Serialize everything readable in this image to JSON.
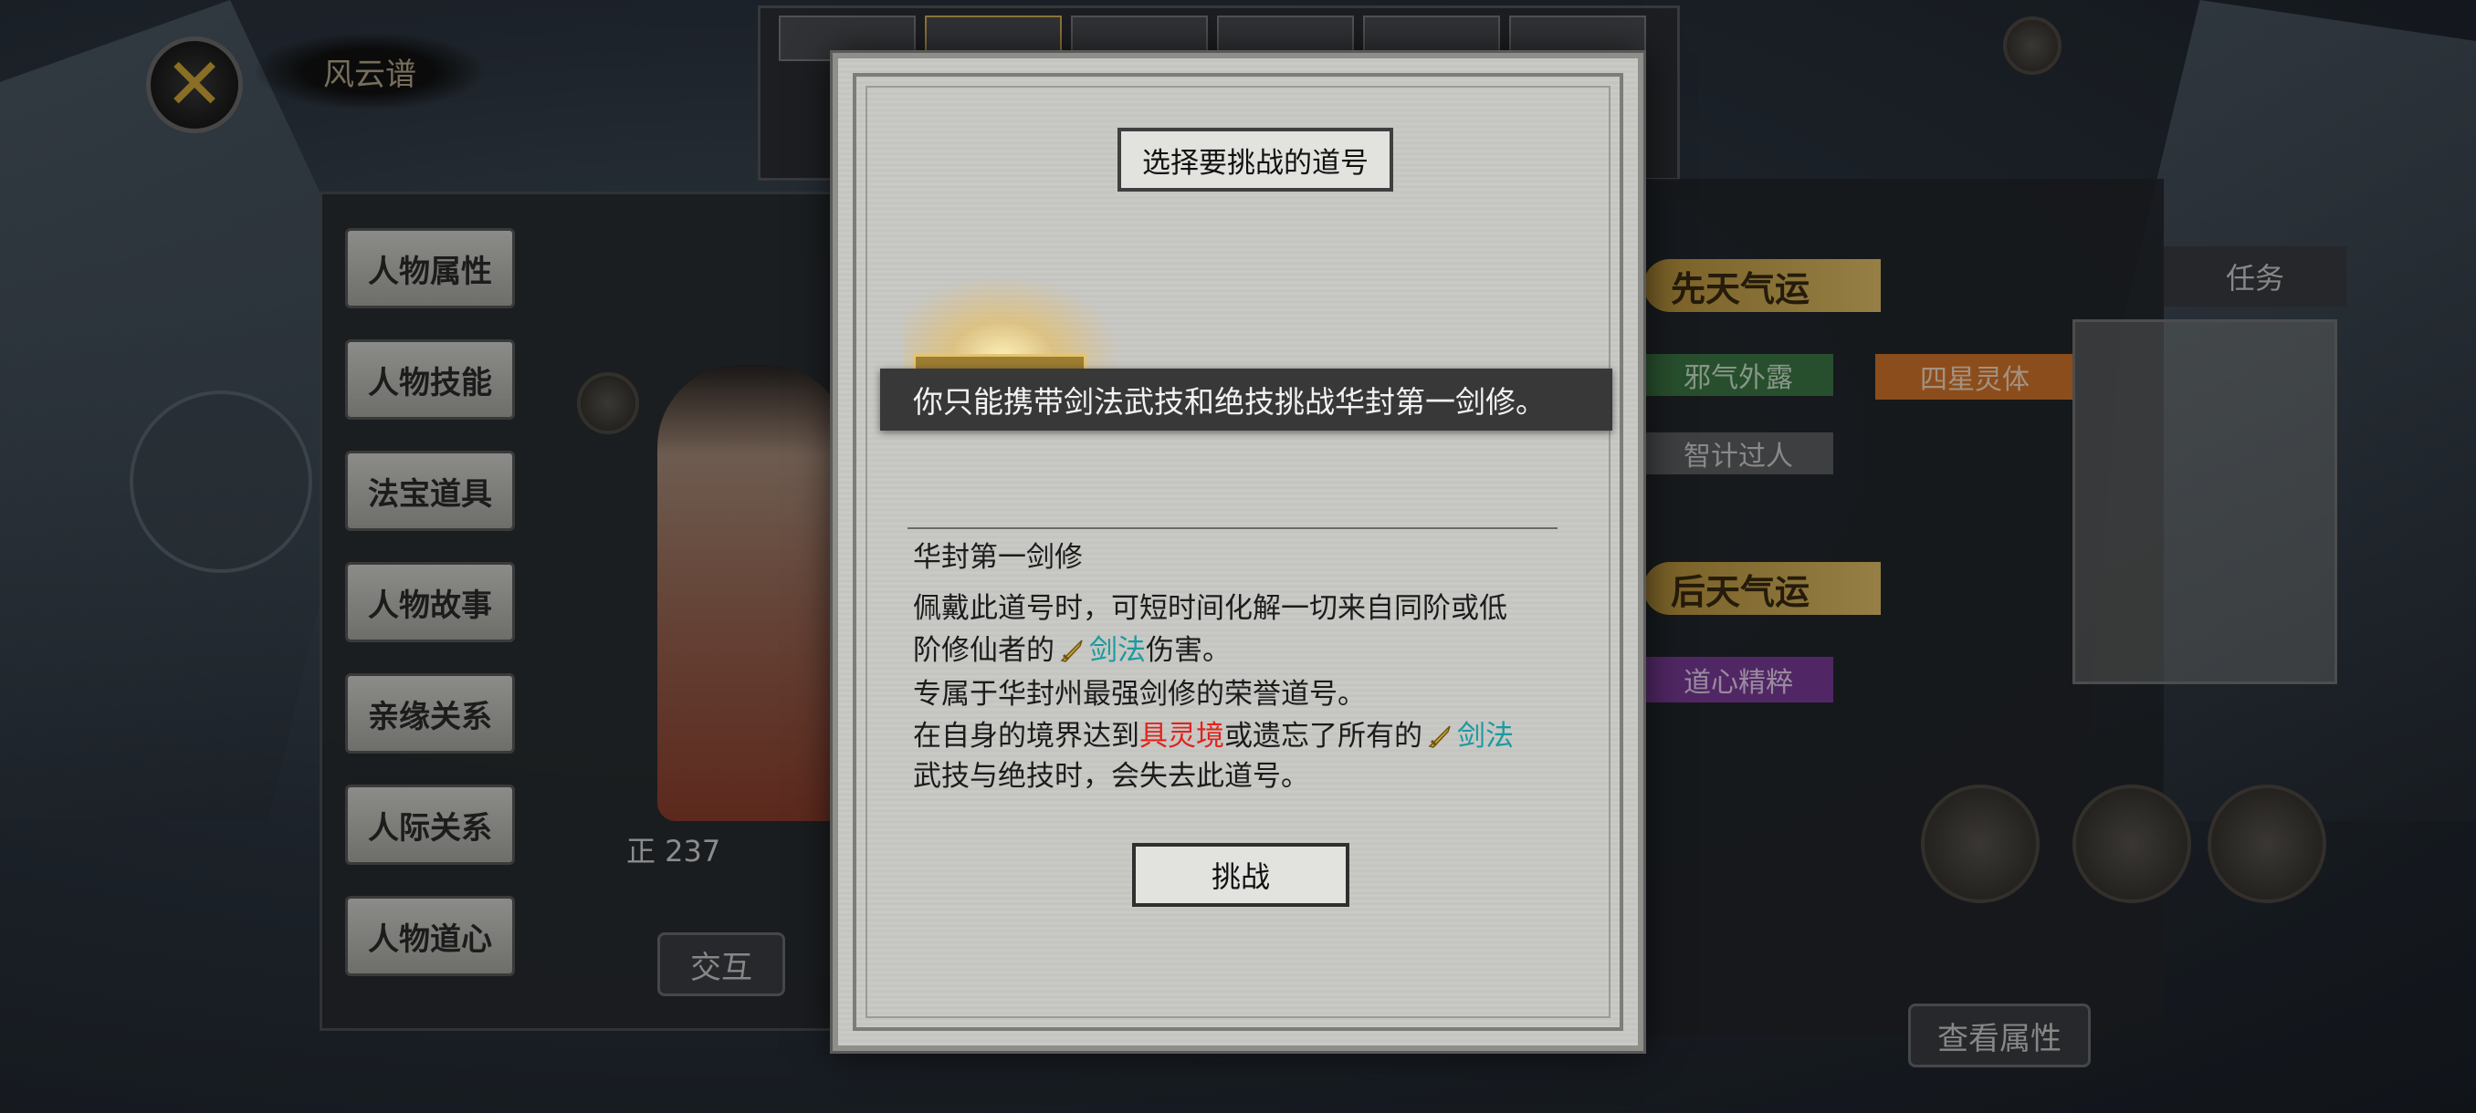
{
  "background": {
    "header_title": "风云谱",
    "side_tabs": [
      "人物属性",
      "人物技能",
      "法宝道具",
      "人物故事",
      "亲缘关系",
      "人际关系",
      "人物道心"
    ],
    "right_badges": {
      "innate": "先天气运",
      "acquired": "后天气运"
    },
    "right_tags": [
      "邪气外露",
      "智计过人",
      "四星灵体",
      "道心精粹"
    ],
    "task_box": {
      "title": "任务"
    },
    "character_value": "正 237",
    "interact_button": "交互",
    "view_attributes_button": "查看属性"
  },
  "modal": {
    "title": "选择要挑战的道号",
    "tooltip": "你只能携带剑法武技和绝技挑战华封第一剑修。",
    "taoist_name": "华封第一剑修",
    "desc_line1": "佩戴此道号时，可短时间化解一切来自同阶或低",
    "desc_line2_pre": "阶修仙者的",
    "desc_line2_kw": "剑法",
    "desc_line2_post": "伤害。",
    "desc_line3": "专属于华封州最强剑修的荣誉道号。",
    "desc_line4_pre": "在自身的境界达到",
    "desc_line4_red": "具灵境",
    "desc_line4_mid": "或遗忘了所有的",
    "desc_line4_kw": "剑法",
    "desc_line5": "武技与绝技时，会失去此道号。",
    "challenge_button": "挑战"
  },
  "colors": {
    "keyword_teal": "#1a9aa0",
    "realm_red": "#e0241c",
    "gold": "#d4a93a"
  },
  "icons": [
    "close-icon",
    "sword-icon",
    "search-icon",
    "gear-icon"
  ]
}
